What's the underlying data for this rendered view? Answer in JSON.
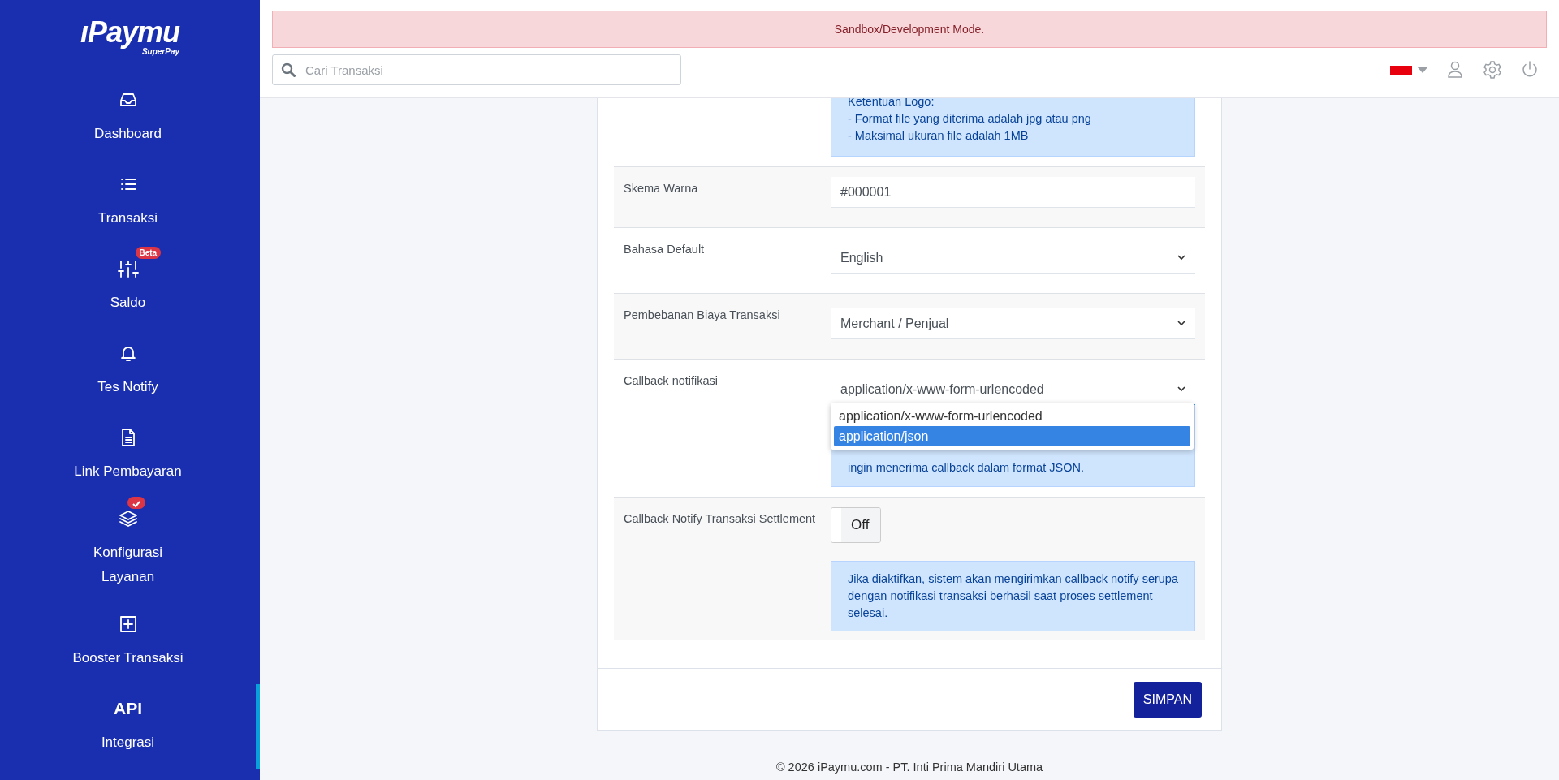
{
  "sidebar": {
    "logo": {
      "name": "ıPaymu",
      "tagline": "SuperPay"
    },
    "items": [
      {
        "label": "Dashboard",
        "selected": false
      },
      {
        "label": "Transaksi",
        "selected": false
      },
      {
        "label": "Saldo",
        "selected": false,
        "badge": {
          "kind": "text",
          "text": "Beta"
        }
      },
      {
        "label": "Tes Notify",
        "selected": false
      },
      {
        "label": "Link Pembayaran",
        "selected": false
      },
      {
        "label": "Konfigurasi Layanan",
        "selected": false,
        "badge": {
          "kind": "check"
        }
      },
      {
        "label": "Booster Transaksi",
        "selected": false
      },
      {
        "label": "Integrasi",
        "selected": true,
        "icon_text": "API"
      }
    ]
  },
  "header": {
    "alert": "Sandbox/Development Mode.",
    "search": {
      "placeholder": "Cari Transaksi"
    }
  },
  "form": {
    "rows": [
      {
        "kind": "info",
        "info": [
          "Ketentuan Logo:",
          "- Format file yang diterima adalah jpg atau png",
          "- Maksimal ukuran file adalah 1MB"
        ]
      },
      {
        "kind": "text",
        "label": "Skema Warna",
        "value": "#000001"
      },
      {
        "kind": "select",
        "label": "Bahasa Default",
        "value": "English"
      },
      {
        "kind": "select",
        "label": "Pembebanan Biaya Transaksi",
        "value": "Merchant / Penjual"
      },
      {
        "kind": "select-open",
        "label": "Callback notifikasi",
        "value": "application/x-www-form-urlencoded",
        "options": [
          {
            "label": "application/x-www-form-urlencoded",
            "highlighted": false
          },
          {
            "label": "application/json",
            "highlighted": true
          }
        ],
        "info": [
          "ingin menerima callback dalam format JSON."
        ]
      },
      {
        "kind": "toggle",
        "label": "Callback Notify Transaksi Settlement",
        "on": false,
        "toggle_label": "Off",
        "info": [
          "Jika diaktifkan, sistem akan mengirimkan callback notify serupa dengan notifikasi transaksi berhasil saat proses settlement selesai."
        ]
      }
    ],
    "submit": "SIMPAN"
  },
  "footer": "© 2026 iPaymu.com - PT. Inti Prima Mandiri Utama"
}
